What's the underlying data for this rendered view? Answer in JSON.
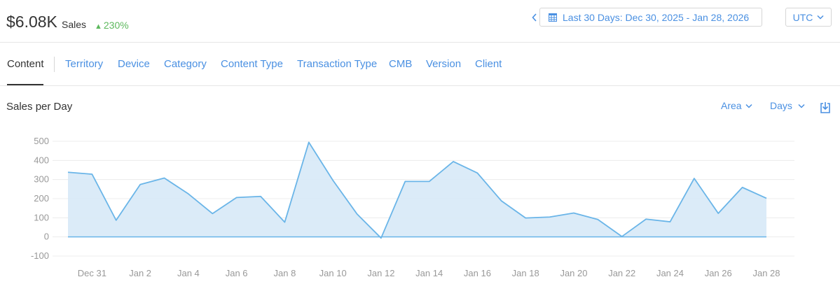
{
  "header": {
    "amount": "$6.08K",
    "sales_label": "Sales",
    "change_arrow": "▲",
    "change_value": "230%",
    "date_range": "Last 30 Days: Dec 30, 2025 - Jan 28, 2026",
    "timezone": "UTC",
    "icons": {
      "prev": "chevron-left-icon",
      "calendar": "calendar-icon",
      "dropdown": "chevron-down-icon"
    }
  },
  "tabs": [
    {
      "label": "Content",
      "active": true
    },
    {
      "label": "Territory"
    },
    {
      "label": "Device"
    },
    {
      "label": "Category"
    },
    {
      "label": "Content Type"
    },
    {
      "label": "Transaction Type"
    },
    {
      "label": "CMB"
    },
    {
      "label": "Version"
    },
    {
      "label": "Client"
    }
  ],
  "chart_header": {
    "title": "Sales per Day",
    "chart_type_select": "Area",
    "interval_select": "Days",
    "download_icon": "download-icon"
  },
  "colors": {
    "accent": "#4a90e2",
    "positive": "#5cb85c",
    "area_fill": "#d7e9f7",
    "area_line": "#6ab5e8"
  },
  "chart_data": {
    "type": "area",
    "title": "Sales per Day",
    "ylim": [
      -100,
      500
    ],
    "yticks": [
      500,
      400,
      300,
      200,
      100,
      0,
      -100
    ],
    "x_tick_labels": [
      "Dec 31",
      "Jan 2",
      "Jan 4",
      "Jan 6",
      "Jan 8",
      "Jan 10",
      "Jan 12",
      "Jan 14",
      "Jan 16",
      "Jan 18",
      "Jan 20",
      "Jan 22",
      "Jan 24",
      "Jan 26",
      "Jan 28"
    ],
    "x": [
      "Dec 30",
      "Dec 31",
      "Jan 1",
      "Jan 2",
      "Jan 3",
      "Jan 4",
      "Jan 5",
      "Jan 6",
      "Jan 7",
      "Jan 8",
      "Jan 9",
      "Jan 10",
      "Jan 11",
      "Jan 12",
      "Jan 13",
      "Jan 14",
      "Jan 15",
      "Jan 16",
      "Jan 17",
      "Jan 18",
      "Jan 19",
      "Jan 20",
      "Jan 21",
      "Jan 22",
      "Jan 23",
      "Jan 24",
      "Jan 25",
      "Jan 26",
      "Jan 27",
      "Jan 28"
    ],
    "values": [
      338,
      328,
      87,
      274,
      308,
      225,
      122,
      206,
      212,
      77,
      495,
      296,
      120,
      -6,
      290,
      290,
      394,
      334,
      188,
      99,
      104,
      125,
      91,
      2,
      93,
      79,
      306,
      123,
      259,
      202
    ],
    "grid": true,
    "legend": "none"
  }
}
